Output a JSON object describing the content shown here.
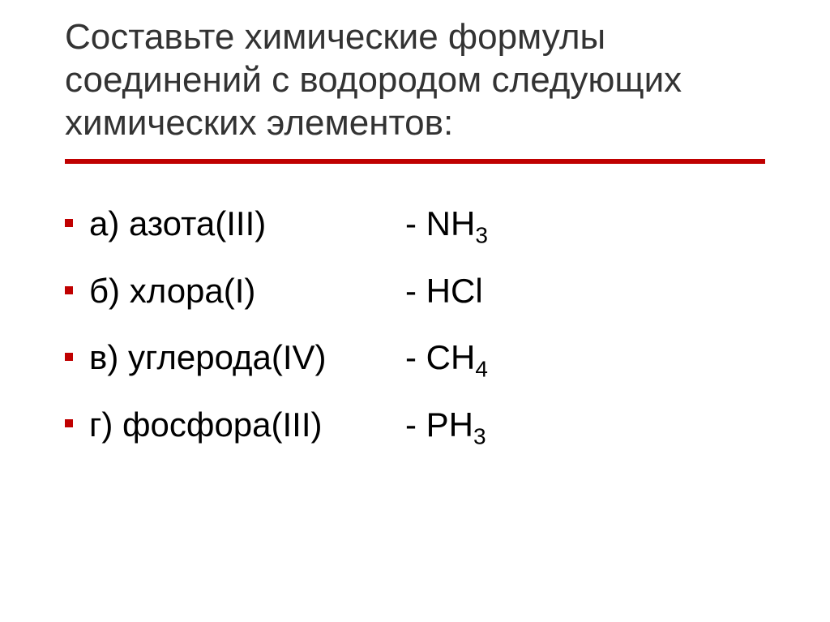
{
  "title": "Составьте химические формулы соединений с водородом следующих химических элементов:",
  "rows": [
    {
      "label": "а) азота(III)",
      "formula_prefix": "- NH",
      "formula_sub": "3"
    },
    {
      "label": "б) хлора(I)",
      "formula_prefix": "- HCl",
      "formula_sub": ""
    },
    {
      "label": "в) углерода(IV)",
      "formula_prefix": "- CH",
      "formula_sub": "4"
    },
    {
      "label": "г) фосфора(III)",
      "formula_prefix": "- PH",
      "formula_sub": "3"
    }
  ]
}
